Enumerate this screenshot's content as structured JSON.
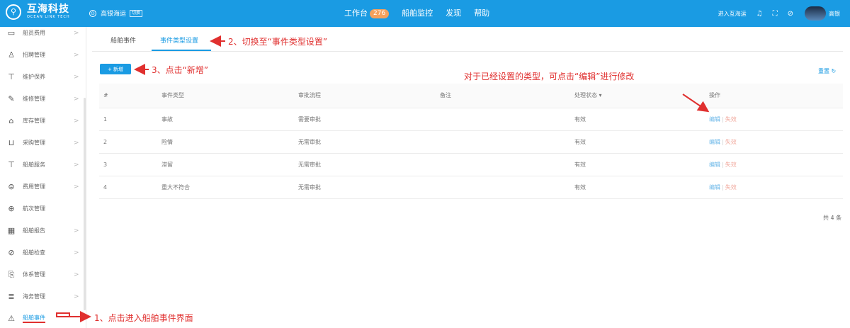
{
  "header": {
    "logo_cn": "互海科技",
    "logo_en": "OCEAN LINK TECH",
    "company": "高银海运",
    "company_switch": "切换",
    "nav": [
      {
        "label": "工作台",
        "badge": "276"
      },
      {
        "label": "船舶监控"
      },
      {
        "label": "发现"
      },
      {
        "label": "帮助"
      }
    ],
    "enter_label": "进入互海运",
    "username": "高银"
  },
  "sidebar": {
    "items": [
      {
        "label": "船员费用",
        "icon": "▭",
        "arrow": ">"
      },
      {
        "label": "招聘管理",
        "icon": "♙",
        "arrow": ">"
      },
      {
        "label": "维护保养",
        "icon": "⊤",
        "arrow": ">"
      },
      {
        "label": "维修管理",
        "icon": "✎",
        "arrow": ">"
      },
      {
        "label": "库存管理",
        "icon": "⌂",
        "arrow": ">"
      },
      {
        "label": "采购管理",
        "icon": "⊔",
        "arrow": ">"
      },
      {
        "label": "船舶服务",
        "icon": "⊤",
        "arrow": ">"
      },
      {
        "label": "费用管理",
        "icon": "⊜",
        "arrow": ">"
      },
      {
        "label": "航次管理",
        "icon": "⊕",
        "arrow": ""
      },
      {
        "label": "船舶报告",
        "icon": "▦",
        "arrow": ">"
      },
      {
        "label": "船舶检查",
        "icon": "⊘",
        "arrow": ">"
      },
      {
        "label": "体系管理",
        "icon": "⎘",
        "arrow": ">"
      },
      {
        "label": "海务管理",
        "icon": "≣",
        "arrow": ">"
      },
      {
        "label": "船舶事件",
        "icon": "⚠",
        "arrow": ""
      }
    ]
  },
  "tabs": [
    {
      "label": "船舶事件"
    },
    {
      "label": "事件类型设置"
    }
  ],
  "toolbar": {
    "add_label": "+ 新增",
    "reset_label": "重置 ↻"
  },
  "table": {
    "columns": [
      "#",
      "事件类型",
      "审批流程",
      "备注",
      "处理状态 ▾",
      "操作"
    ],
    "rows": [
      {
        "no": "1",
        "type": "事故",
        "flow": "需要审批",
        "note": "",
        "status": "有效",
        "edit": "编辑",
        "invalid": "失效"
      },
      {
        "no": "2",
        "type": "险情",
        "flow": "无需审批",
        "note": "",
        "status": "有效",
        "edit": "编辑",
        "invalid": "失效"
      },
      {
        "no": "3",
        "type": "滞留",
        "flow": "无需审批",
        "note": "",
        "status": "有效",
        "edit": "编辑",
        "invalid": "失效"
      },
      {
        "no": "4",
        "type": "重大不符合",
        "flow": "无需审批",
        "note": "",
        "status": "有效",
        "edit": "编辑",
        "invalid": "失效"
      }
    ],
    "total": "共 4 条"
  },
  "annotations": {
    "step1": "1、点击进入船舶事件界面",
    "step2": "2、切换至“事件类型设置”",
    "step3": "3、点击“新增”",
    "edit_hint": "对于已经设置的类型，可点击“编辑”进行修改"
  },
  "colors": {
    "primary": "#1a9be3",
    "annotation": "#e0302f",
    "badge": "#f5a15c"
  }
}
